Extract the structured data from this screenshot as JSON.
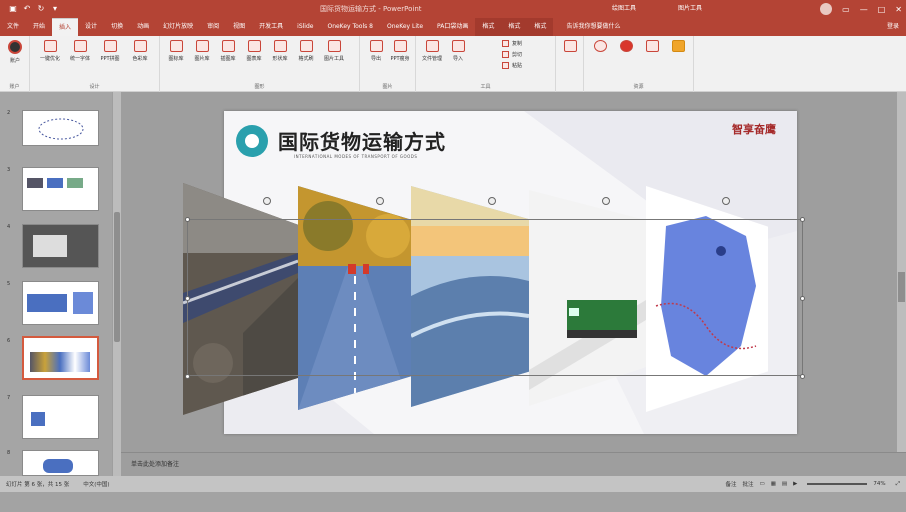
{
  "window": {
    "document_title": "国际货物运输方式 - PowerPoint",
    "context_tab_group": "绘图工具",
    "context_tab_group2": "图片工具",
    "account_label": "登录",
    "help_label": "告诉我你想要做什么"
  },
  "tabs": [
    {
      "label": "文件"
    },
    {
      "label": "开始"
    },
    {
      "label": "插入"
    },
    {
      "label": "设计"
    },
    {
      "label": "切换"
    },
    {
      "label": "动画"
    },
    {
      "label": "幻灯片放映"
    },
    {
      "label": "审阅"
    },
    {
      "label": "视图"
    },
    {
      "label": "开发工具"
    },
    {
      "label": "iSlide"
    },
    {
      "label": "OneKey Tools 8"
    },
    {
      "label": "OneKey Lite"
    },
    {
      "label": "PA口袋动画"
    },
    {
      "label": "格式"
    },
    {
      "label": "格式"
    },
    {
      "label": "格式"
    }
  ],
  "ribbon": {
    "groups": [
      {
        "label": "账户"
      },
      {
        "label": "设计"
      },
      {
        "label": "图形"
      },
      {
        "label": "图片"
      },
      {
        "label": "工具"
      },
      {
        "label": "资源"
      }
    ],
    "buttons": [
      "账户",
      "一键优化",
      "统一字体",
      "PPT拼图",
      "色彩库",
      "图标库",
      "图片库",
      "插图库",
      "图表库",
      "形状库",
      "格式刷",
      "图片工具",
      "导出",
      "PPT瘦身",
      "文件管理",
      "导入",
      "复制",
      "剪切",
      "粘贴"
    ]
  },
  "slides": [
    {
      "number": "2"
    },
    {
      "number": "3"
    },
    {
      "number": "4"
    },
    {
      "number": "5"
    },
    {
      "number": "6"
    },
    {
      "number": "7"
    },
    {
      "number": "8"
    }
  ],
  "slide": {
    "title": "国际货物运输方式",
    "subtitle": "INTERNATIONAL MODES OF TRANSPORT OF GOODS",
    "logo_text": "智享奋鹰"
  },
  "notes": {
    "placeholder": "单击此处添加备注"
  },
  "status": {
    "slide_info": "幻灯片 第 6 张，共 15 张",
    "language": "中文(中国)",
    "notes_btn": "备注",
    "comments_btn": "批注",
    "zoom": "74%"
  },
  "colors": {
    "accent": "#b44435",
    "title_teal": "#2aa0ad",
    "train_green": "#2c7a3a",
    "map_blue": "#4d6fd8"
  }
}
